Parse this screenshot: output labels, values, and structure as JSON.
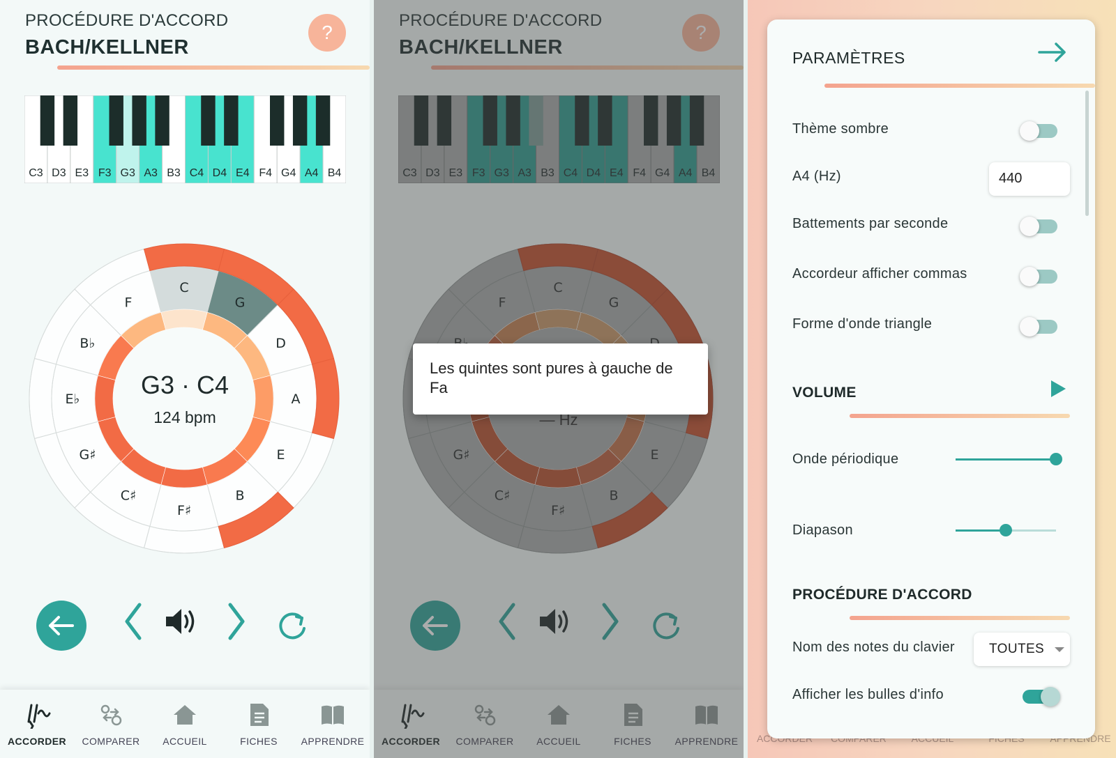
{
  "tuning": {
    "subtitle": "PROCÉDURE D'ACCORD",
    "title": "BACH/KELLNER",
    "help_symbol": "?",
    "keyboard_labels": [
      "C3",
      "D3",
      "E3",
      "F3",
      "G3",
      "A3",
      "B3",
      "C4",
      "D4",
      "E4",
      "F4",
      "G4",
      "A4",
      "B4"
    ],
    "current_notes": "G3 · C4",
    "bpm": "124 bpm",
    "circle_notes": [
      "C",
      "G",
      "D",
      "A",
      "E",
      "B",
      "F♯",
      "C♯",
      "G♯",
      "E♭",
      "B♭",
      "F"
    ]
  },
  "panel2": {
    "tooltip": "Les quintes sont pures à gauche de Fa",
    "hz_text": "— Hz"
  },
  "nav": {
    "items": [
      {
        "label": "ACCORDER",
        "icon": "tuning-fork-icon"
      },
      {
        "label": "COMPARER",
        "icon": "compare-icon"
      },
      {
        "label": "ACCUEIL",
        "icon": "home-icon"
      },
      {
        "label": "FICHES",
        "icon": "document-icon"
      },
      {
        "label": "APPRENDRE",
        "icon": "book-icon"
      }
    ]
  },
  "settings": {
    "title": "PARAMÈTRES",
    "dark_theme": "Thème sombre",
    "a4_label": "A4 (Hz)",
    "a4_value": "440",
    "beats": "Battements par seconde",
    "commas": "Accordeur afficher commas",
    "triangle": "Forme d'onde triangle",
    "volume": "VOLUME",
    "periodic": "Onde périodique",
    "periodic_level": 1.0,
    "diapason": "Diapason",
    "diapason_level": 0.5,
    "procedure": "PROCÉDURE D'ACCORD",
    "note_names": "Nom des notes du clavier",
    "note_names_value": "TOUTES",
    "tooltips": "Afficher les bulles d'info"
  },
  "colors": {
    "teal": "#2fa49a",
    "key_highlight": "#48e3cf",
    "orange": "#f26b45",
    "peach": "#f7b49a"
  }
}
